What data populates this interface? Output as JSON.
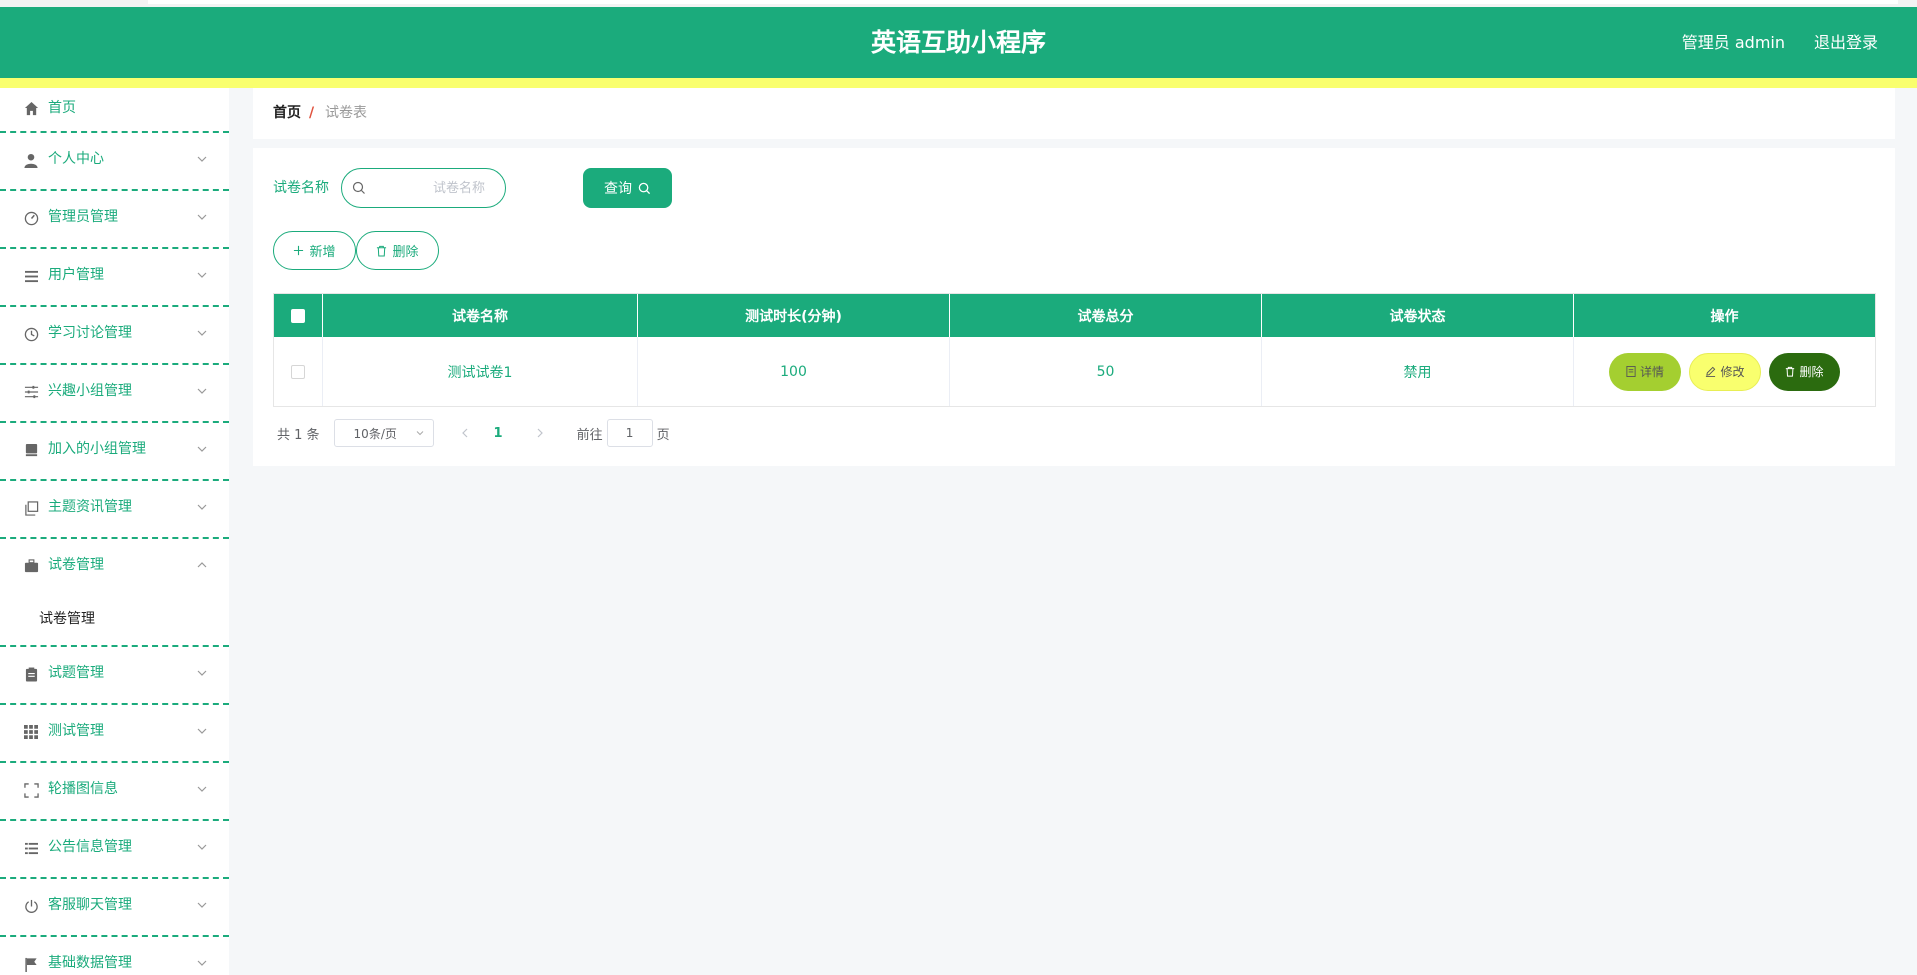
{
  "header": {
    "title": "英语互助小程序",
    "admin": "管理员 admin",
    "logout": "退出登录"
  },
  "sidebar": {
    "items": [
      {
        "label": "首页",
        "icon": "home-icon"
      },
      {
        "label": "个人中心",
        "icon": "user-icon"
      },
      {
        "label": "管理员管理",
        "icon": "gauge-icon"
      },
      {
        "label": "用户管理",
        "icon": "list-icon"
      },
      {
        "label": "学习讨论管理",
        "icon": "clock-icon"
      },
      {
        "label": "兴趣小组管理",
        "icon": "sliders-icon"
      },
      {
        "label": "加入的小组管理",
        "icon": "stack-icon"
      },
      {
        "label": "主题资讯管理",
        "icon": "copy-icon"
      },
      {
        "label": "试卷管理",
        "icon": "briefcase-icon"
      },
      {
        "label": "试题管理",
        "icon": "clipboard-icon"
      },
      {
        "label": "测试管理",
        "icon": "grid-icon"
      },
      {
        "label": "轮播图信息",
        "icon": "fullscreen-icon"
      },
      {
        "label": "公告信息管理",
        "icon": "list-icon"
      },
      {
        "label": "客服聊天管理",
        "icon": "power-icon"
      },
      {
        "label": "基础数据管理",
        "icon": "flag-icon"
      }
    ],
    "submenu": {
      "label": "试卷管理"
    }
  },
  "breadcrumb": {
    "home": "首页",
    "sep": "/",
    "current": "试卷表"
  },
  "search": {
    "label": "试卷名称",
    "placeholder": "试卷名称",
    "button": "查询"
  },
  "actions": {
    "add": "新增",
    "delete": "删除"
  },
  "table": {
    "headers": [
      "试卷名称",
      "测试时长(分钟)",
      "试卷总分",
      "试卷状态",
      "操作"
    ],
    "rows": [
      {
        "name": "测试试卷1",
        "duration": "100",
        "score": "50",
        "status": "禁用"
      }
    ],
    "ops": {
      "detail": "详情",
      "edit": "修改",
      "delete": "删除"
    }
  },
  "pagination": {
    "total": "共 1 条",
    "size": "10条/页",
    "current": "1",
    "goto": "前往",
    "goto_value": "1",
    "page_suffix": "页"
  },
  "colors": {
    "primary": "#1bab7c",
    "accent_yellow": "#f9ff6e",
    "detail": "#a4cf30",
    "danger_dark": "#2b6b0f"
  }
}
